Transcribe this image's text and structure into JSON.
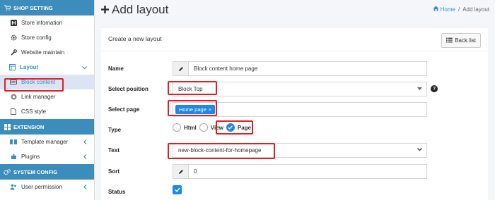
{
  "sidebar": {
    "sections": [
      {
        "label": "SHOP SETTING"
      },
      {
        "label": "EXTENSION"
      },
      {
        "label": "SYSTEM CONFIG"
      }
    ],
    "shop_items": [
      {
        "label": "Store infomation"
      },
      {
        "label": "Store config"
      },
      {
        "label": "Website maintain"
      }
    ],
    "layout": {
      "label": "Layout"
    },
    "layout_items": [
      {
        "label": "Block content"
      },
      {
        "label": "Link manager"
      },
      {
        "label": "CSS style"
      }
    ],
    "extension_items": [
      {
        "label": "Template manager"
      },
      {
        "label": "Plugins"
      }
    ],
    "system_items": [
      {
        "label": "User permission"
      }
    ]
  },
  "header": {
    "title": "Add layout",
    "breadcrumb_home": "Home",
    "breadcrumb_separator": "/",
    "breadcrumb_current": "Add layout"
  },
  "form": {
    "card_title": "Create a new layout",
    "back_label": "Back list",
    "name_label": "Name",
    "name_value": "Block content home page",
    "position_label": "Select position",
    "position_value": "Block Top",
    "page_label": "Select page",
    "page_tag": "Home page",
    "page_tag_remove": "×",
    "type_label": "Type",
    "type_options": [
      "Html",
      "View",
      "Page"
    ],
    "type_selected": "Page",
    "text_label": "Text",
    "text_value": "new-block-content-for-homepage",
    "sort_label": "Sort",
    "sort_value": "0",
    "status_label": "Status",
    "status_checked": true,
    "help_glyph": "?"
  },
  "colors": {
    "accent": "#3c8dbc",
    "primary": "#1e88e5",
    "highlight": "#e02020"
  }
}
